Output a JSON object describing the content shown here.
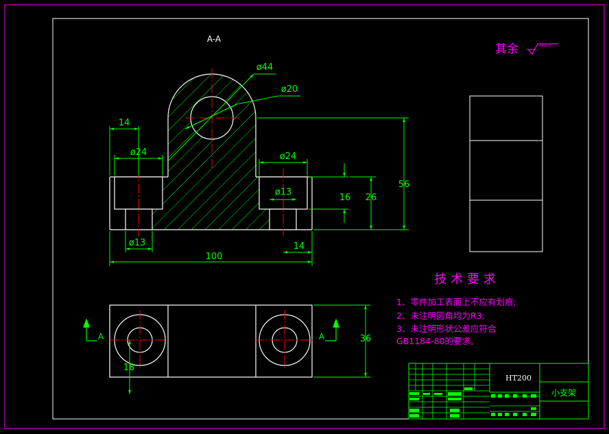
{
  "drawing": {
    "section_label": "A-A",
    "surface_note": {
      "text": "其余",
      "symbol_value": "Ra12.5"
    },
    "dimensions": {
      "d44": "ø44",
      "d20": "ø20",
      "left_offset": "14",
      "left_bore": "ø24",
      "right_bore": "ø24",
      "right_hole": "ø13",
      "left_hole": "ø13",
      "bore_depth": "16",
      "base_height": "26",
      "total_height": "56",
      "total_length": "100",
      "right_offset": "14",
      "plan_width": "36",
      "plan_hole_offset": "18"
    },
    "view_markers": {
      "left": "A",
      "right": "A"
    },
    "tech_requirements": {
      "title": "技 术 要 求",
      "items": [
        "1、零件加工表面上不应有划痕;",
        "2、未注明圆角均为R3;",
        "3、未注明形状公差应符合",
        "GB1184-80的要求。"
      ]
    },
    "title_block": {
      "material": "HT200",
      "part_name": "小支架"
    },
    "colors": {
      "background": "#000000",
      "outline": "#ffffff",
      "dimension": "#00ff00",
      "center_line": "#ff0000",
      "annotation": "#ff00ff",
      "border": "#ff00ff"
    }
  }
}
